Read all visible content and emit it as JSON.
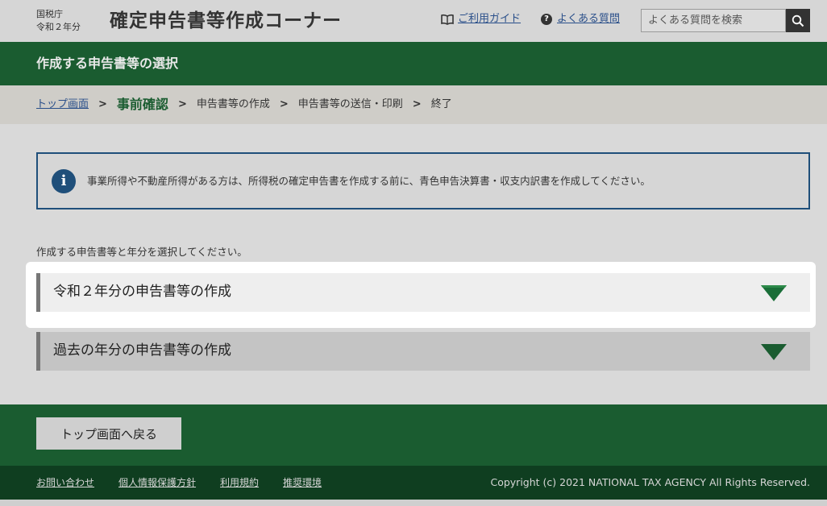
{
  "header": {
    "org_line1": "国税庁",
    "org_line2": "令和２年分",
    "site_title": "確定申告書等作成コーナー",
    "guide_link": "ご利用ガイド",
    "faq_link": "よくある質問",
    "search_placeholder": "よくある質問を検索"
  },
  "banner": {
    "title": "作成する申告書等の選択"
  },
  "breadcrumb": {
    "home": "トップ画面",
    "current": "事前確認",
    "step3": "申告書等の作成",
    "step4": "申告書等の送信・印刷",
    "step5": "終了",
    "separator": ">"
  },
  "notice": {
    "icon": "i",
    "text": "事業所得や不動産所得がある方は、所得税の確定申告書を作成する前に、青色申告決算書・収支内訳書を作成してください。"
  },
  "instruction": "作成する申告書等と年分を選択してください。",
  "accordions": [
    {
      "label": "令和２年分の申告書等の作成",
      "expanded": false
    },
    {
      "label": "過去の年分の申告書等の作成",
      "expanded": false
    }
  ],
  "footer": {
    "back_button": "トップ画面へ戻る",
    "links": [
      "お問い合わせ",
      "個人情報保護方針",
      "利用規約",
      "推奨環境"
    ],
    "copyright": "Copyright (c) 2021 NATIONAL TAX AGENCY All Rights Reserved."
  },
  "colors": {
    "brand_green": "#1a5c30",
    "footer_dark_green": "#0f3e20",
    "notice_blue": "#1f4f7a",
    "link_blue": "#2a4f8a",
    "chevron_green": "#1a5c30"
  },
  "icons": {
    "guide": "book-icon",
    "faq": "question-circle-icon",
    "search": "magnifier-icon",
    "notice": "info-circle-icon",
    "accordion": "chevron-down-icon"
  }
}
